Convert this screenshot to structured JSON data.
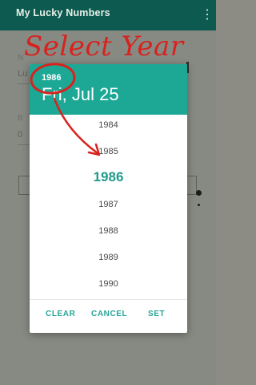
{
  "app": {
    "title": "My Lucky Numbers",
    "menu_icon": "more-vertical-icon"
  },
  "background_form": {
    "field1_label": "N",
    "field1_value": "Lu",
    "field2_label": "B",
    "field2_value": "0"
  },
  "dialog": {
    "header": {
      "year": "1986",
      "date": "Fri, Jul 25"
    },
    "years": [
      "1984",
      "1985",
      "1986",
      "1987",
      "1988",
      "1989",
      "1990"
    ],
    "selected_year": "1986",
    "actions": {
      "clear": "CLEAR",
      "cancel": "CANCEL",
      "set": "SET"
    }
  },
  "annotation": {
    "text": "Select Year"
  },
  "colors": {
    "toolbar": "#0d5b50",
    "dialog_header": "#1da795",
    "accent": "#27a595",
    "annotation": "#d8221e"
  }
}
